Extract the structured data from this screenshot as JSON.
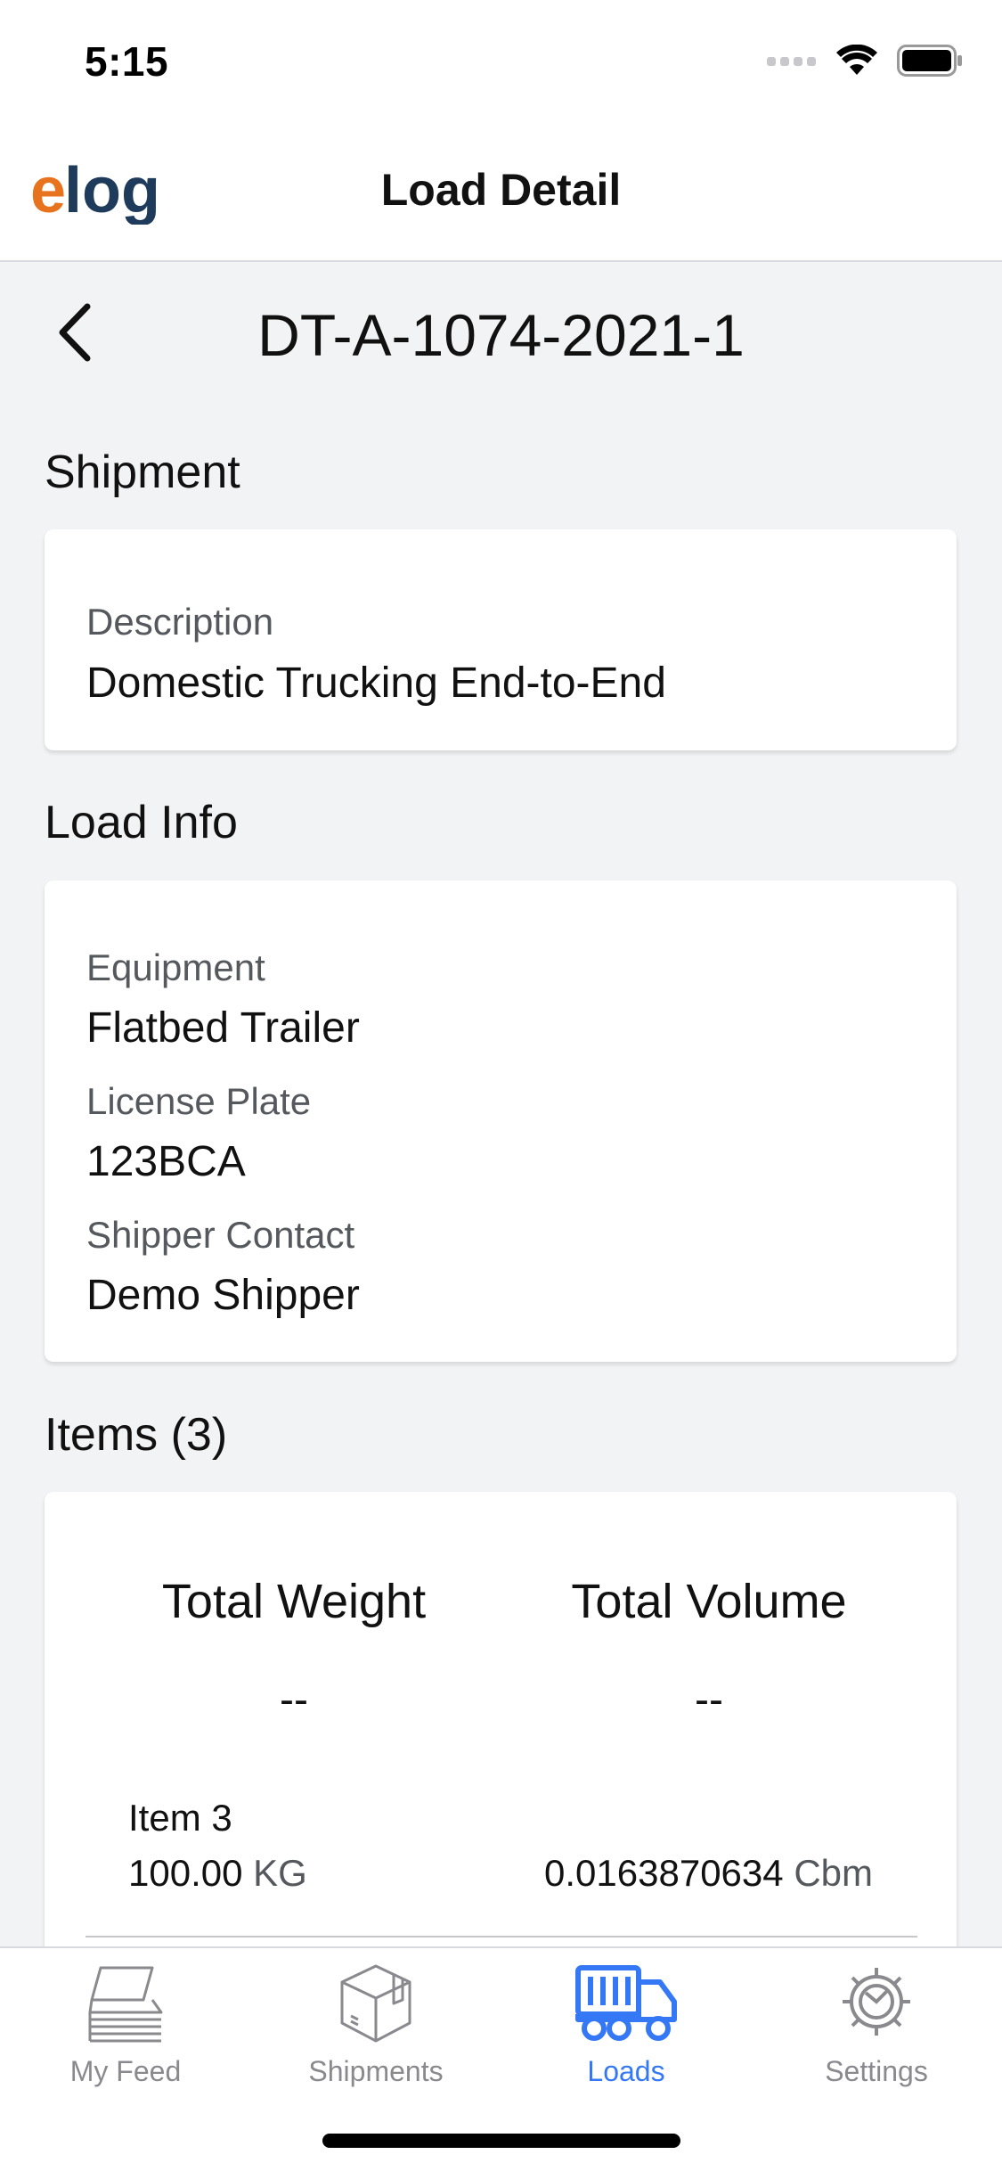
{
  "status_bar": {
    "time": "5:15"
  },
  "header": {
    "logo_text": "elog",
    "title": "Load Detail"
  },
  "load": {
    "number": "DT-A-1074-2021-1"
  },
  "shipment": {
    "heading": "Shipment",
    "description_label": "Description",
    "description_value": "Domestic Trucking End-to-End"
  },
  "load_info": {
    "heading": "Load Info",
    "equipment_label": "Equipment",
    "equipment_value": "Flatbed Trailer",
    "license_label": "License Plate",
    "license_value": "123BCA",
    "contact_label": "Shipper Contact",
    "contact_value": "Demo Shipper"
  },
  "items": {
    "heading": "Items (3)",
    "total_weight_label": "Total Weight",
    "total_weight_value": "--",
    "total_volume_label": "Total Volume",
    "total_volume_value": "--",
    "list": [
      {
        "name": "Item 3",
        "weight": "100.00",
        "weight_unit": "KG",
        "volume": "0.0163870634",
        "volume_unit": "Cbm"
      }
    ]
  },
  "tabs": [
    {
      "label": "My Feed",
      "icon": "feed-icon",
      "active": false
    },
    {
      "label": "Shipments",
      "icon": "package-icon",
      "active": false
    },
    {
      "label": "Loads",
      "icon": "truck-icon",
      "active": true
    },
    {
      "label": "Settings",
      "icon": "gear-icon",
      "active": false
    }
  ],
  "colors": {
    "accent": "#3478f6",
    "logo_orange": "#e8731f",
    "logo_navy": "#1f3b5c",
    "background": "#f2f3f5",
    "inactive_tab": "#8a8a8e"
  }
}
